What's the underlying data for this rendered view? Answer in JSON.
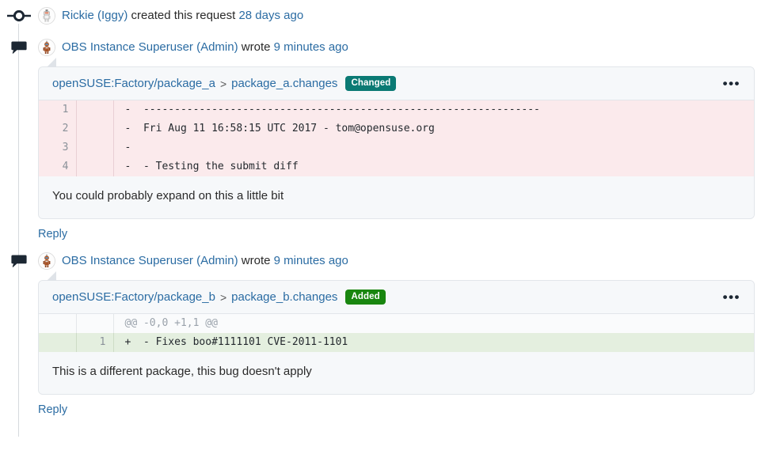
{
  "colors": {
    "link": "#2b6ca3",
    "badge_changed": "#0b7a74",
    "badge_added": "#19860f",
    "diff_delete_bg": "#fbeaec",
    "diff_add_bg": "#e4efdf",
    "card_bg": "#f6f8fa"
  },
  "events": [
    {
      "marker": "commit-node-icon",
      "avatar": "user-avatar-rickie",
      "actor": "Rickie (Iggy)",
      "action": "created this request",
      "timestamp": "28 days ago",
      "has_card": false
    },
    {
      "marker": "comment-bubble-icon",
      "avatar": "user-avatar-obs-superuser",
      "actor": "OBS Instance Superuser (Admin)",
      "action": "wrote",
      "timestamp": "9 minutes ago",
      "has_card": true,
      "card": {
        "project_path": "openSUSE:Factory/package_a",
        "separator": ">",
        "file_name": "package_a.changes",
        "badge_label": "Changed",
        "badge_kind": "changed",
        "menu_label": "•••",
        "diff_rows": [
          {
            "kind": "del",
            "old_no": "1",
            "new_no": "",
            "text": "-  ----------------------------------------------------------------"
          },
          {
            "kind": "del",
            "old_no": "2",
            "new_no": "",
            "text": "-  Fri Aug 11 16:58:15 UTC 2017 - tom@opensuse.org"
          },
          {
            "kind": "del",
            "old_no": "3",
            "new_no": "",
            "text": "-  "
          },
          {
            "kind": "del",
            "old_no": "4",
            "new_no": "",
            "text": "-  - Testing the submit diff"
          }
        ],
        "comment": "You could probably expand on this a little bit"
      },
      "reply_label": "Reply"
    },
    {
      "marker": "comment-bubble-icon",
      "avatar": "user-avatar-obs-superuser",
      "actor": "OBS Instance Superuser (Admin)",
      "action": "wrote",
      "timestamp": "9 minutes ago",
      "has_card": true,
      "card": {
        "project_path": "openSUSE:Factory/package_b",
        "separator": ">",
        "file_name": "package_b.changes",
        "badge_label": "Added",
        "badge_kind": "added",
        "menu_label": "•••",
        "diff_rows": [
          {
            "kind": "hunk",
            "old_no": "",
            "new_no": "",
            "text": "@@ -0,0 +1,1 @@"
          },
          {
            "kind": "add",
            "old_no": "",
            "new_no": "1",
            "text": "+  - Fixes boo#1111101 CVE-2011-1101"
          }
        ],
        "comment": "This is a different package, this bug doesn't apply"
      },
      "reply_label": "Reply"
    }
  ]
}
